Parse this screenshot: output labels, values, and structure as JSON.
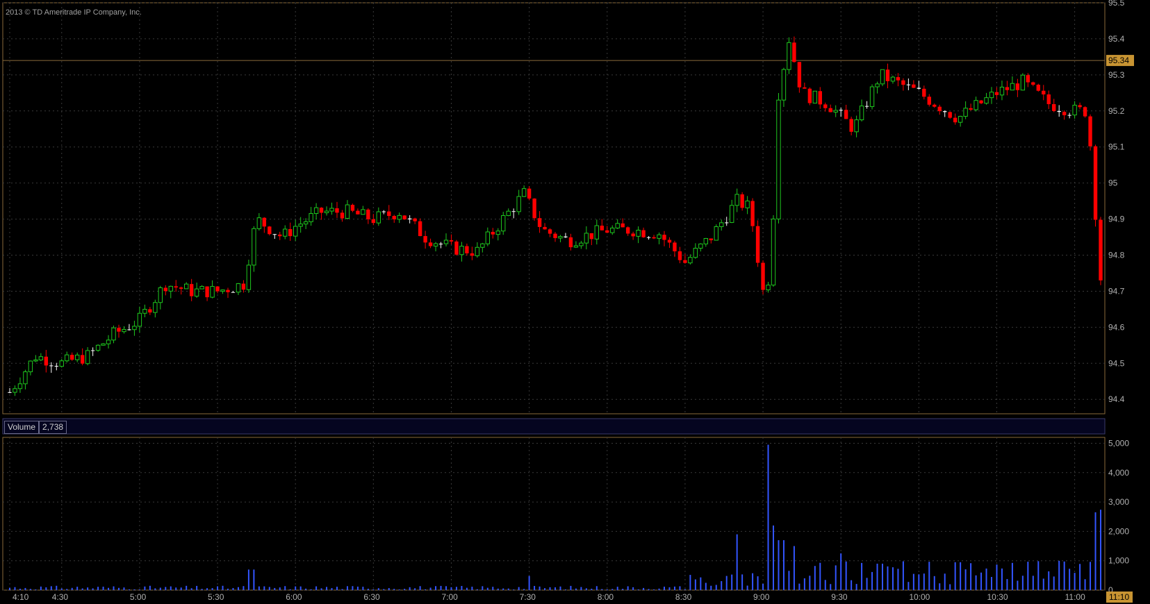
{
  "copyright": "2013 © TD Ameritrade IP Company, Inc.",
  "volume_panel": {
    "label": "Volume",
    "value": "2,738"
  },
  "last_price_label": "95.34",
  "current_time_label": "11:10",
  "colors": {
    "up": "#1ec81e",
    "down": "#ff0000",
    "doji": "#ffffff",
    "volume": "#3355ff",
    "grid": "#3a3a3a",
    "axis_text": "#b0b0b0",
    "frame": "#8a6a3a",
    "badge": "#c89432"
  },
  "chart_data": [
    {
      "type": "candlestick",
      "ylim": [
        94.36,
        95.5
      ],
      "y_ticks": [
        "94.4",
        "94.5",
        "94.6",
        "94.7",
        "94.8",
        "94.9",
        "95",
        "95.1",
        "95.2",
        "95.3",
        "95.4",
        "95.5"
      ],
      "grid": true,
      "reference_line": 95.34,
      "trend_keypoints": [
        [
          "4:10",
          94.42
        ],
        [
          "4:20",
          94.52
        ],
        [
          "4:30",
          94.5
        ],
        [
          "4:40",
          94.52
        ],
        [
          "4:50",
          94.58
        ],
        [
          "5:00",
          94.62
        ],
        [
          "5:10",
          94.72
        ],
        [
          "5:20",
          94.7
        ],
        [
          "5:30",
          94.7
        ],
        [
          "5:40",
          94.72
        ],
        [
          "5:45",
          94.9
        ],
        [
          "5:55",
          94.85
        ],
        [
          "6:00",
          94.88
        ],
        [
          "6:10",
          94.92
        ],
        [
          "6:20",
          94.92
        ],
        [
          "6:30",
          94.9
        ],
        [
          "6:40",
          94.92
        ],
        [
          "6:50",
          94.85
        ],
        [
          "7:00",
          94.82
        ],
        [
          "7:10",
          94.81
        ],
        [
          "7:20",
          94.9
        ],
        [
          "7:28",
          94.97
        ],
        [
          "7:35",
          94.87
        ],
        [
          "7:45",
          94.84
        ],
        [
          "8:00",
          94.87
        ],
        [
          "8:10",
          94.87
        ],
        [
          "8:20",
          94.86
        ],
        [
          "8:30",
          94.78
        ],
        [
          "8:40",
          94.85
        ],
        [
          "8:50",
          94.95
        ],
        [
          "8:55",
          94.93
        ],
        [
          "9:00",
          94.7
        ],
        [
          "9:03",
          94.75
        ],
        [
          "9:06",
          95.25
        ],
        [
          "9:10",
          95.4
        ],
        [
          "9:15",
          95.25
        ],
        [
          "9:25",
          95.22
        ],
        [
          "9:35",
          95.15
        ],
        [
          "9:45",
          95.3
        ],
        [
          "10:00",
          95.25
        ],
        [
          "10:15",
          95.18
        ],
        [
          "10:30",
          95.25
        ],
        [
          "10:40",
          95.28
        ],
        [
          "10:50",
          95.22
        ],
        [
          "11:00",
          95.2
        ],
        [
          "11:05",
          95.2
        ],
        [
          "11:10",
          94.73
        ]
      ]
    },
    {
      "type": "bar",
      "series": [
        {
          "name": "Volume"
        }
      ],
      "ylim": [
        0,
        5200
      ],
      "y_ticks": [
        "0",
        "1,000",
        "2,000",
        "3,000",
        "4,000",
        "5,000"
      ],
      "last_value": 2738,
      "spikes": [
        [
          "5:43",
          700
        ],
        [
          "7:30",
          480
        ],
        [
          "8:50",
          1900
        ],
        [
          "9:03",
          4950
        ],
        [
          "9:05",
          2200
        ],
        [
          "9:07",
          1700
        ],
        [
          "9:12",
          1500
        ],
        [
          "9:30",
          1250
        ],
        [
          "9:45",
          900
        ],
        [
          "10:15",
          950
        ],
        [
          "11:09",
          2650
        ],
        [
          "11:10",
          2738
        ]
      ]
    }
  ],
  "x_axis": {
    "start_time": "4:10",
    "end_time": "11:10",
    "ticks": [
      "4:10",
      "4:30",
      "5:00",
      "5:30",
      "6:00",
      "6:30",
      "7:00",
      "7:30",
      "8:00",
      "8:30",
      "9:00",
      "9:30",
      "10:00",
      "10:30",
      "11:00"
    ]
  }
}
